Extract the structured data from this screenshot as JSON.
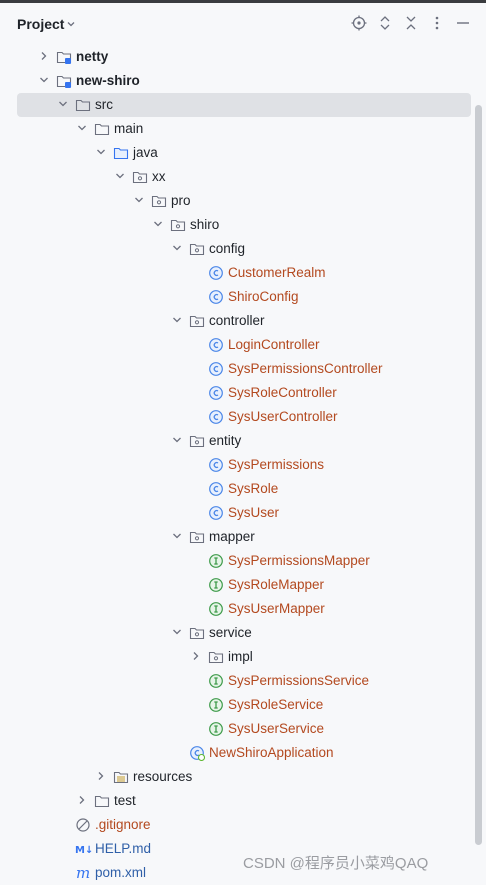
{
  "panel": {
    "title": "Project",
    "toolbar": [
      "locate-icon",
      "expand-all-icon",
      "collapse-all-icon",
      "more-icon",
      "hide-icon"
    ]
  },
  "tree": [
    {
      "label": "netty",
      "level": 1,
      "arrow": "right",
      "icon": "module-folder",
      "style": "bold"
    },
    {
      "label": "new-shiro",
      "level": 1,
      "arrow": "down",
      "icon": "module-folder",
      "style": "bold"
    },
    {
      "label": "src",
      "level": 2,
      "arrow": "down",
      "icon": "folder",
      "style": "normal",
      "selected": true
    },
    {
      "label": "main",
      "level": 3,
      "arrow": "down",
      "icon": "folder",
      "style": "normal"
    },
    {
      "label": "java",
      "level": 4,
      "arrow": "down",
      "icon": "source-folder",
      "style": "normal"
    },
    {
      "label": "xx",
      "level": 5,
      "arrow": "down",
      "icon": "package",
      "style": "normal"
    },
    {
      "label": "pro",
      "level": 6,
      "arrow": "down",
      "icon": "package",
      "style": "normal"
    },
    {
      "label": "shiro",
      "level": 7,
      "arrow": "down",
      "icon": "package",
      "style": "normal"
    },
    {
      "label": "config",
      "level": 8,
      "arrow": "down",
      "icon": "package",
      "style": "normal"
    },
    {
      "label": "CustomerRealm",
      "level": 9,
      "arrow": "none",
      "icon": "class",
      "style": "red"
    },
    {
      "label": "ShiroConfig",
      "level": 9,
      "arrow": "none",
      "icon": "class",
      "style": "red"
    },
    {
      "label": "controller",
      "level": 8,
      "arrow": "down",
      "icon": "package",
      "style": "normal"
    },
    {
      "label": "LoginController",
      "level": 9,
      "arrow": "none",
      "icon": "class",
      "style": "red"
    },
    {
      "label": "SysPermissionsController",
      "level": 9,
      "arrow": "none",
      "icon": "class",
      "style": "red"
    },
    {
      "label": "SysRoleController",
      "level": 9,
      "arrow": "none",
      "icon": "class",
      "style": "red"
    },
    {
      "label": "SysUserController",
      "level": 9,
      "arrow": "none",
      "icon": "class",
      "style": "red"
    },
    {
      "label": "entity",
      "level": 8,
      "arrow": "down",
      "icon": "package",
      "style": "normal"
    },
    {
      "label": "SysPermissions",
      "level": 9,
      "arrow": "none",
      "icon": "class",
      "style": "red"
    },
    {
      "label": "SysRole",
      "level": 9,
      "arrow": "none",
      "icon": "class",
      "style": "red"
    },
    {
      "label": "SysUser",
      "level": 9,
      "arrow": "none",
      "icon": "class",
      "style": "red"
    },
    {
      "label": "mapper",
      "level": 8,
      "arrow": "down",
      "icon": "package",
      "style": "normal"
    },
    {
      "label": "SysPermissionsMapper",
      "level": 9,
      "arrow": "none",
      "icon": "interface",
      "style": "red"
    },
    {
      "label": "SysRoleMapper",
      "level": 9,
      "arrow": "none",
      "icon": "interface",
      "style": "red"
    },
    {
      "label": "SysUserMapper",
      "level": 9,
      "arrow": "none",
      "icon": "interface",
      "style": "red"
    },
    {
      "label": "service",
      "level": 8,
      "arrow": "down",
      "icon": "package",
      "style": "normal"
    },
    {
      "label": "impl",
      "level": 9,
      "arrow": "right",
      "icon": "package",
      "style": "normal"
    },
    {
      "label": "SysPermissionsService",
      "level": 9,
      "arrow": "none",
      "icon": "interface",
      "style": "red"
    },
    {
      "label": "SysRoleService",
      "level": 9,
      "arrow": "none",
      "icon": "interface",
      "style": "red"
    },
    {
      "label": "SysUserService",
      "level": 9,
      "arrow": "none",
      "icon": "interface",
      "style": "red"
    },
    {
      "label": "NewShiroApplication",
      "level": 8,
      "arrow": "none",
      "icon": "spring-class",
      "style": "red"
    },
    {
      "label": "resources",
      "level": 4,
      "arrow": "right",
      "icon": "resources-folder",
      "style": "normal"
    },
    {
      "label": "test",
      "level": 3,
      "arrow": "right",
      "icon": "folder",
      "style": "normal"
    },
    {
      "label": ".gitignore",
      "level": 2,
      "arrow": "none",
      "icon": "ignore-file",
      "style": "red"
    },
    {
      "label": "HELP.md",
      "level": 2,
      "arrow": "none",
      "icon": "markdown-file",
      "style": "blue"
    },
    {
      "label": "pom.xml",
      "level": 2,
      "arrow": "none",
      "icon": "maven-file",
      "style": "blue"
    }
  ],
  "watermark": "CSDN @程序员小菜鸡QAQ",
  "colors": {
    "modified": "#b3491f",
    "changed": "#2f5fa8",
    "selection": "#dfe1e5",
    "class_icon": "#4a86e8",
    "interface_icon": "#3e9b4a"
  }
}
